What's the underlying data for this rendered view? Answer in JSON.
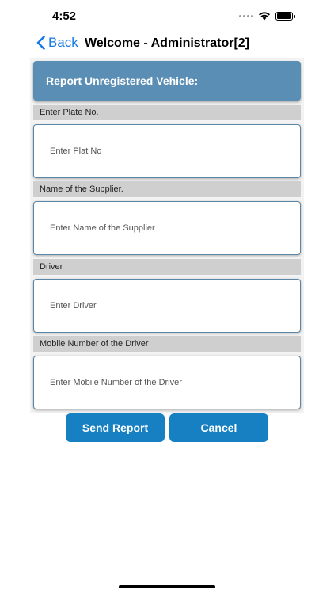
{
  "status_bar": {
    "time": "4:52",
    "icons": [
      "signal-icon",
      "wifi-icon",
      "battery-icon"
    ]
  },
  "nav": {
    "back_label": "Back",
    "title": "Welcome - Administrator[2]"
  },
  "form": {
    "header": "Report Unregistered Vehicle:",
    "fields": [
      {
        "label": "Enter Plate No.",
        "placeholder": "Enter Plat No"
      },
      {
        "label": "Name of the Supplier.",
        "placeholder": "Enter Name of the Supplier"
      },
      {
        "label": "Driver",
        "placeholder": "Enter Driver"
      },
      {
        "label": "Mobile Number of the Driver",
        "placeholder": "Enter Mobile Number of the Driver"
      }
    ]
  },
  "actions": {
    "send_label": "Send Report",
    "cancel_label": "Cancel"
  },
  "colors": {
    "accent": "#1780c2",
    "header_bg": "#5a8eb4",
    "link": "#1a7ae6",
    "label_bg": "#cfcfcf"
  }
}
